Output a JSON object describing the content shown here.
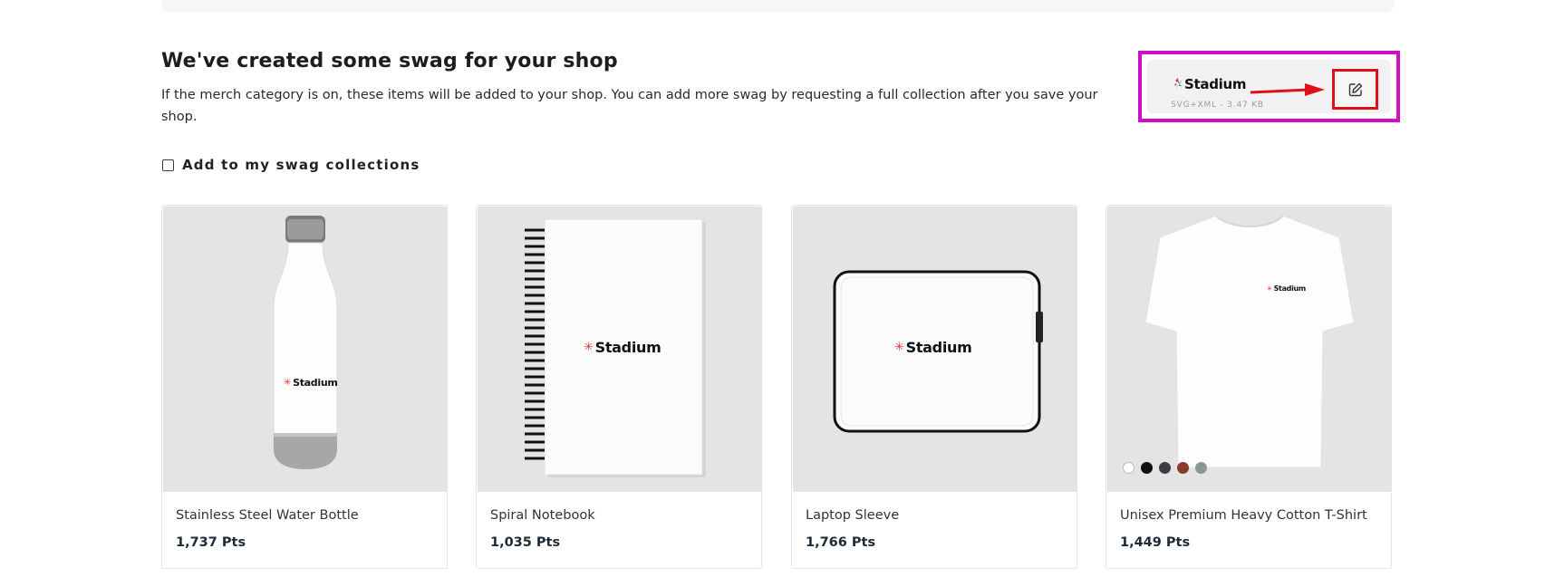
{
  "section": {
    "heading": "We've created some swag for your shop",
    "description": "If the merch category is on, these items will be added to your shop. You can add more swag by requesting a full collection after you save your shop."
  },
  "logo_file": {
    "brand_name": "Stadium",
    "meta": "SVG+XML - 3.47 KB",
    "edit_icon": "edit-icon"
  },
  "checkbox": {
    "label": "Add to my swag collections",
    "checked": false
  },
  "products": [
    {
      "name": "Stainless Steel Water Bottle",
      "price": "1,737 Pts",
      "brand": "Stadium"
    },
    {
      "name": "Spiral Notebook",
      "price": "1,035 Pts",
      "brand": "Stadium"
    },
    {
      "name": "Laptop Sleeve",
      "price": "1,766 Pts",
      "brand": "Stadium"
    },
    {
      "name": "Unisex Premium Heavy Cotton T-Shirt",
      "price": "1,449 Pts",
      "brand": "Stadium",
      "swatches": [
        "#ffffff",
        "#111111",
        "#3b3f44",
        "#8a3a2c",
        "#8a9a8e"
      ]
    }
  ],
  "colors": {
    "highlight_box": "#d010c6",
    "edit_box": "#e0101a",
    "arrow": "#e0101a"
  }
}
